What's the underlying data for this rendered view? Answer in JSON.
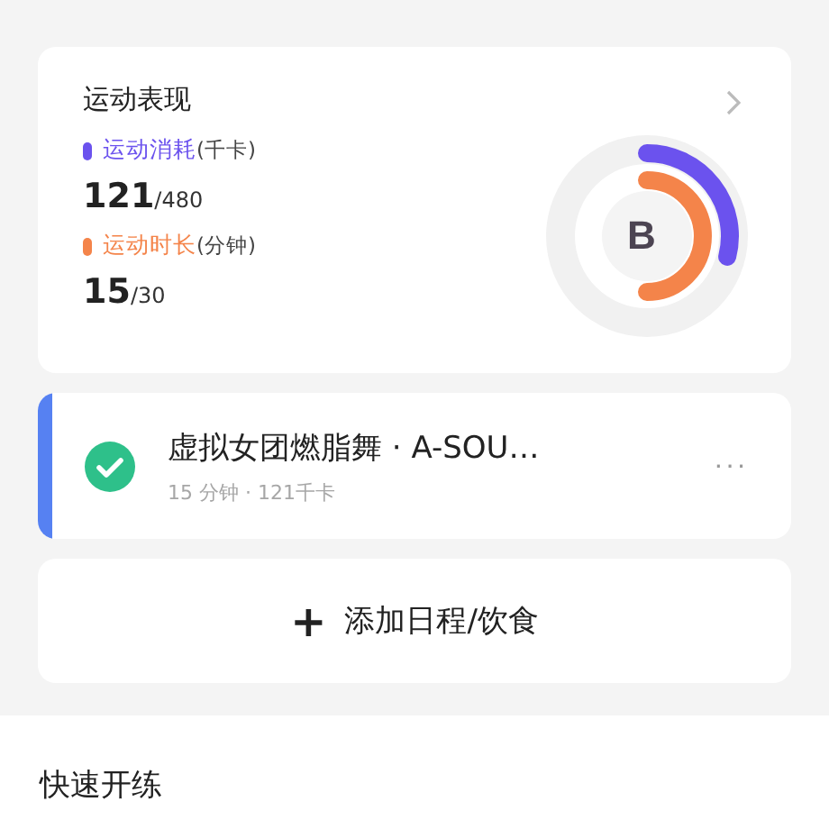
{
  "performance": {
    "title": "运动表现",
    "grade": "B",
    "metrics": [
      {
        "label": "运动消耗",
        "unit": "(千卡)",
        "value": "121",
        "target": "/480",
        "color": "#6b52ee"
      },
      {
        "label": "运动时长",
        "unit": "(分钟)",
        "value": "15",
        "target": "/30",
        "color": "#f4844a"
      }
    ]
  },
  "task": {
    "title": "虚拟女团燃脂舞 · A-SOU…",
    "meta": "15 分钟 · 121千卡",
    "done": true,
    "more": "···"
  },
  "add_button": {
    "icon": "+",
    "label": "添加日程/饮食"
  },
  "section_title": "快速开练"
}
